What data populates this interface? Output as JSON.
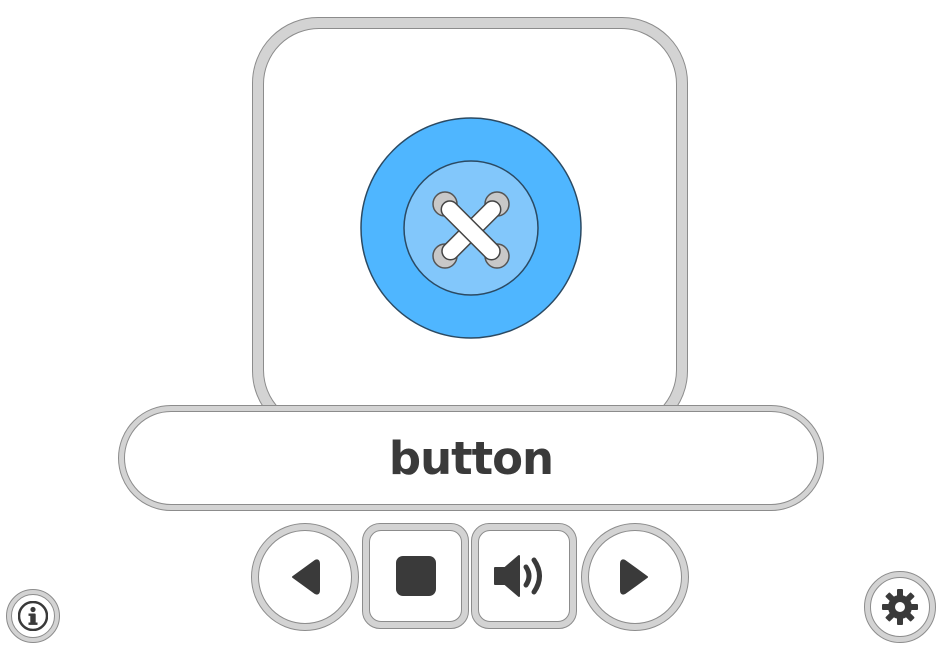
{
  "card": {
    "word": "button",
    "picture_icon": "sewing-button-icon"
  },
  "controls": {
    "previous": {
      "icon": "triangle-left-icon"
    },
    "stop": {
      "icon": "stop-square-icon"
    },
    "sound": {
      "icon": "speaker-icon"
    },
    "next": {
      "icon": "triangle-right-icon"
    }
  },
  "corner": {
    "info": {
      "icon": "info-icon",
      "label": "i"
    },
    "settings": {
      "icon": "gear-icon"
    }
  },
  "colors": {
    "button_outer": "#4fb6ff",
    "button_inner": "#82c7fb",
    "frame_gray": "#d3d3d3",
    "outline": "#8c8c8c",
    "icon_dark": "#3a3a3a"
  }
}
